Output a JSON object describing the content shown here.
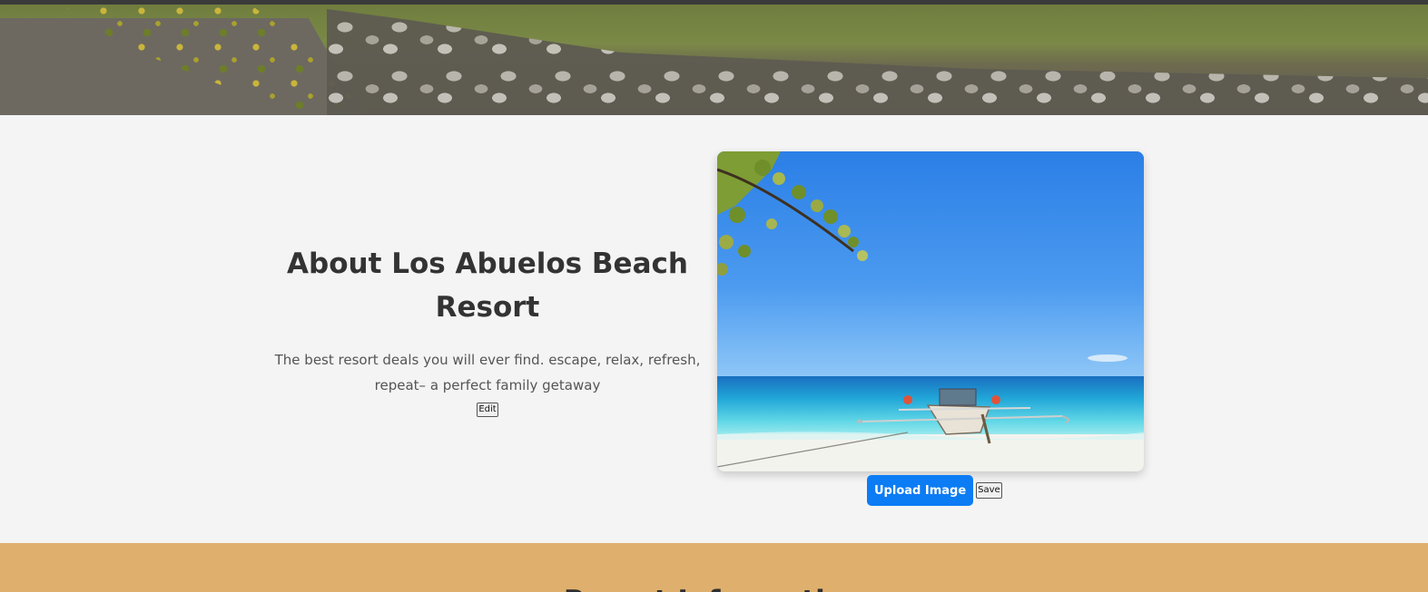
{
  "about": {
    "title": "About Los Abuelos Beach Resort",
    "description": "The best resort deals you will ever find. escape, relax, refresh, repeat– a perfect family getaway",
    "edit_label": "Edit"
  },
  "image_controls": {
    "upload_label": "Upload Image",
    "save_label": "Save"
  },
  "info_section": {
    "title": "Resort Information"
  },
  "colors": {
    "upload_button": "#0c7cf4",
    "info_band": "#dfb06d",
    "background": "#f4f4f4"
  }
}
